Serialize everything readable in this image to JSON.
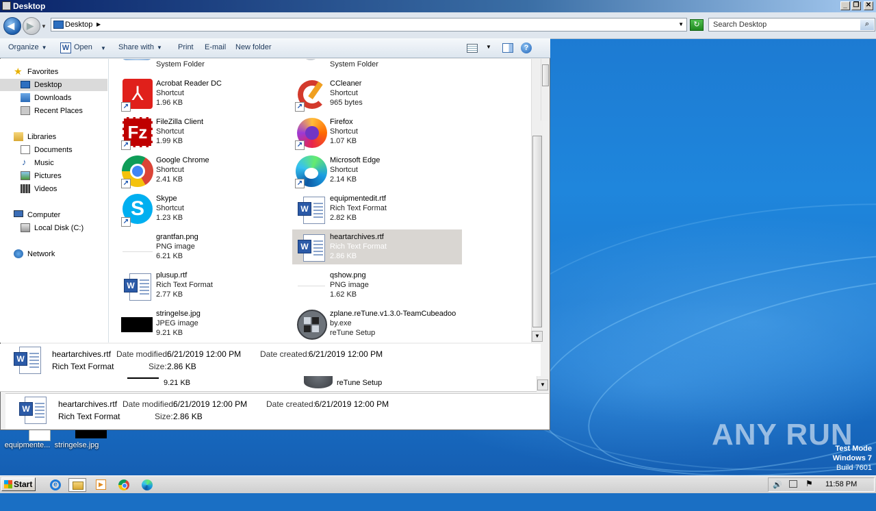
{
  "window": {
    "title": "Desktop",
    "caption_buttons": {
      "minimize": "_",
      "maximize": "❐",
      "close": "✕"
    }
  },
  "address": {
    "location": "Desktop",
    "search_placeholder": "Search Desktop"
  },
  "toolbar": {
    "organize": "Organize",
    "open": "Open",
    "share_with": "Share with",
    "print": "Print",
    "email": "E-mail",
    "new_folder": "New folder"
  },
  "nav": {
    "favorites": "Favorites",
    "desktop": "Desktop",
    "downloads": "Downloads",
    "recent_places": "Recent Places",
    "libraries": "Libraries",
    "documents": "Documents",
    "music": "Music",
    "pictures": "Pictures",
    "videos": "Videos",
    "computer": "Computer",
    "local_disk": "Local Disk (C:)",
    "network": "Network"
  },
  "files": {
    "top_left_type": "System Folder",
    "top_right_type": "System Folder",
    "items": [
      {
        "name": "Acrobat Reader DC",
        "type": "Shortcut",
        "size": "1.96 KB",
        "icon": "acrobat-icon"
      },
      {
        "name": "CCleaner",
        "type": "Shortcut",
        "size": "965 bytes",
        "icon": "ccleaner-icon"
      },
      {
        "name": "FileZilla Client",
        "type": "Shortcut",
        "size": "1.99 KB",
        "icon": "filezilla-icon"
      },
      {
        "name": "Firefox",
        "type": "Shortcut",
        "size": "1.07 KB",
        "icon": "firefox-icon"
      },
      {
        "name": "Google Chrome",
        "type": "Shortcut",
        "size": "2.41 KB",
        "icon": "chrome-icon"
      },
      {
        "name": "Microsoft Edge",
        "type": "Shortcut",
        "size": "2.14 KB",
        "icon": "edge-icon"
      },
      {
        "name": "Skype",
        "type": "Shortcut",
        "size": "1.23 KB",
        "icon": "skype-icon"
      },
      {
        "name": "equipmentedit.rtf",
        "type": "Rich Text Format",
        "size": "2.82 KB",
        "icon": "rtf-icon"
      },
      {
        "name": "grantfan.png",
        "type": "PNG image",
        "size": "6.21 KB",
        "icon": "png-icon"
      },
      {
        "name": "heartarchives.rtf",
        "type": "Rich Text Format",
        "size": "2.86 KB",
        "icon": "rtf-icon"
      },
      {
        "name": "plusup.rtf",
        "type": "Rich Text Format",
        "size": "2.77 KB",
        "icon": "rtf-icon"
      },
      {
        "name": "qshow.png",
        "type": "PNG image",
        "size": "1.62 KB",
        "icon": "png-icon"
      },
      {
        "name": "stringelse.jpg",
        "type": "JPEG image",
        "size": "9.21 KB",
        "icon": "jpg-icon"
      },
      {
        "name": "zplane.reTune.v1.3.0-TeamCubeadoo",
        "name2": "by.exe",
        "type": "reTune Setup",
        "icon": "exe-icon"
      }
    ],
    "ghost_size": "9.21 KB",
    "ghost_type": "reTune Setup"
  },
  "details": {
    "name": "heartarchives.rtf",
    "type": "Rich Text Format",
    "modified_label": "Date modified:",
    "modified_value": "6/21/2019 12:00 PM",
    "created_label": "Date created:",
    "created_value": "6/21/2019 12:00 PM",
    "size_label": "Size:",
    "size_value": "2.86 KB"
  },
  "desktop_icons": {
    "equipmentedit": "equipmente...",
    "stringelse": "stringelse.jpg"
  },
  "watermark": "ANY RUN",
  "testmode": {
    "line1": "Test Mode",
    "line2": "Windows 7",
    "line3": "Build 7601"
  },
  "taskbar": {
    "start": "Start",
    "clock": "11:58 PM"
  },
  "colors": {
    "selection": "#d9d6d2",
    "desktop": "#1c78d0",
    "title": "#0a246a"
  }
}
